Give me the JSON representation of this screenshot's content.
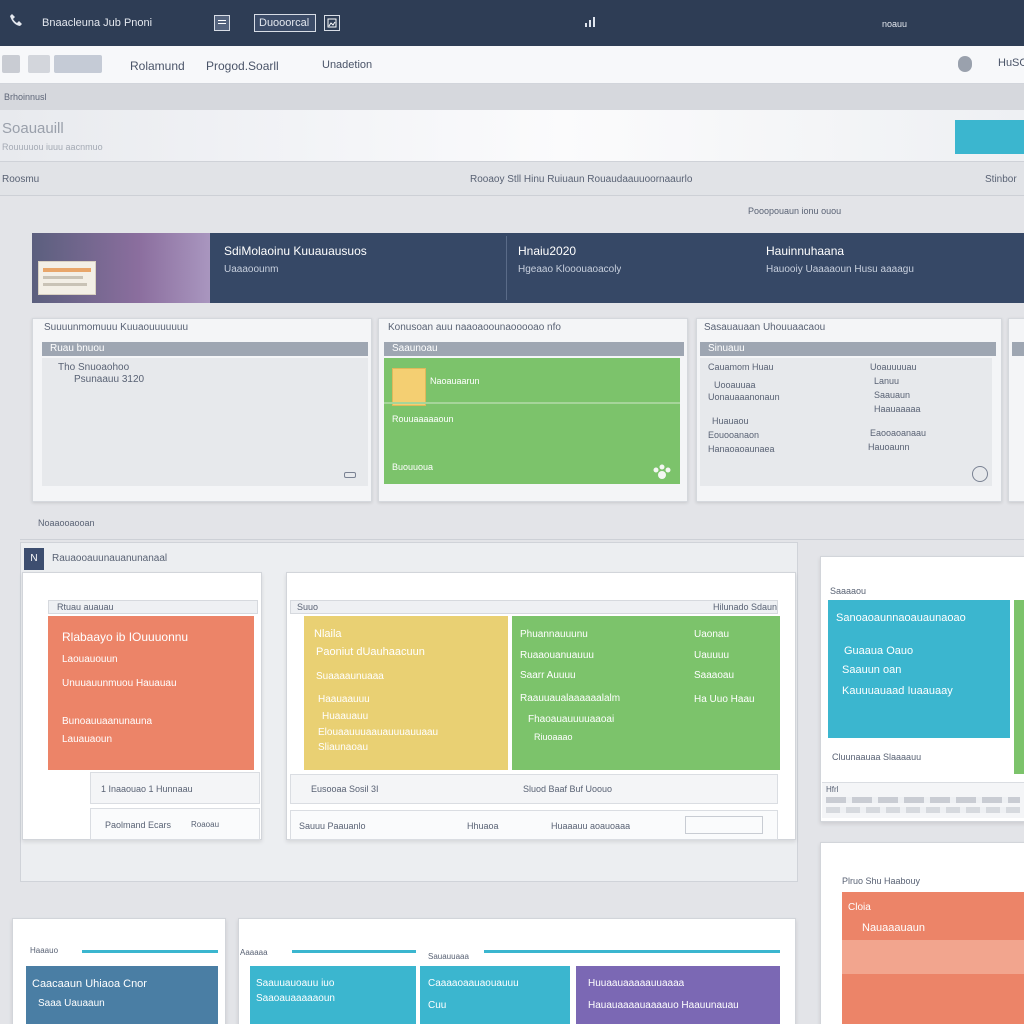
{
  "topbar": {
    "title": "Bnaacleuna Jub Pnoni",
    "doc_label": "Duooorcal",
    "right_text": "noauu"
  },
  "nav": {
    "items": [
      "Rolamund",
      "Progod.Soarll",
      "Unadetion"
    ],
    "user_label": "HuSO"
  },
  "subheader": {
    "label": "Brhoinnusl"
  },
  "hero": {
    "title": "Soauauill",
    "subtitle": "Rouuuuou iuuu aacnmuo"
  },
  "filterbar": {
    "left": "Roosmu",
    "center": "Rooaoy Stll Hinu Ruiuaun Rouaudaauuoornaaurlo",
    "right": "Stinbor"
  },
  "section_caption": "Pooopouaun ionu ouou",
  "banner": {
    "col1_title": "SdiMolaoinu Kuuauausuos",
    "col1_sub": "Uaaaoounm",
    "col2_title": "Hnaiu2020",
    "col2_sub": "Hgeaao Klooouaoacoly",
    "col3_title": "Hauinnuhaana",
    "col3_sub": "Hauooiy Uaaaaoun Husu aaaagu"
  },
  "cards_row1": [
    {
      "title": "Suuuunmomuuu Kuuaouuuuuuu",
      "header": "Ruau bnuou",
      "lines": [
        "Tho Snuoaohoo",
        "Psunaauu 3120"
      ]
    },
    {
      "title": "Konusoan auu naaoaoounaooooao nfo",
      "header": "Saaunoau",
      "green_lines": [
        "Naoauaarun",
        "Rouuaaaaaoun",
        "Buouuoua"
      ]
    },
    {
      "title": "Sasauauaan Uhouuaacaou",
      "header": "Sinuauu",
      "left_lines": [
        "Cauamom Huau",
        "Uooauuaa",
        "Uonauaaanonaun",
        "Huauaou",
        "Eouooanaon",
        "Hanaoaoaunaea"
      ],
      "right_lines": [
        "Uoauuuuau",
        "Lanuu",
        "Saauaun",
        "Haauaaaaa",
        "Eaooaoanaau",
        "Hauoaunn"
      ]
    }
  ],
  "section2_label": "Noaaooaooan",
  "board": {
    "title": "Rauaooauunauanunanaal",
    "left_panel": {
      "header": "Rtuau auauau",
      "orange_title": "Rlabaayo ib IOuuuonnu",
      "orange_lines": [
        "Laouauouun",
        "Unuuauunmuou Hauauau",
        "Bunoauuaanunauna",
        "Lauauaoun"
      ],
      "footer1": "1 Inaaouao 1 Hunnaau",
      "footer2": "Paolmand Ecars",
      "footer2_right": "Roaoau"
    },
    "mid_panel": {
      "header": "Suuo",
      "header_right": "Hilunado Sdaun",
      "yellow_lines": [
        "Nlaila",
        "Paoniut dUauhaacuun",
        "Suaaaaunuaaa",
        "Haauaauuu",
        "Huaauauu",
        "Elouaauuuaauauuuauuaau",
        "Sliaunaoau"
      ],
      "green_left": [
        "Phuannauuunu",
        "Ruaaouanuauuu",
        "Saarr Auuuu",
        "Raauuaualaaaaaalalm",
        "Fhaoauauuuuaaoai",
        "Riuoaaao"
      ],
      "green_right": [
        "Uaonau",
        "Uauuuu",
        "Saaaoau",
        "Ha Uuo Haau"
      ],
      "footer1": "Eusooaa Sosil 3I",
      "footer1_right": "Sluod Baaf Buf Uoouo",
      "footer2": "Sauuu Paauanlo",
      "footer2_mid": "Hhuaoa",
      "footer2_right": "Huaaauu aoauoaaa"
    }
  },
  "right_card": {
    "header": "Saaaaou",
    "cyan_title": "Sanoaoaunnaoauaunaoao",
    "cyan_lines": [
      "Guaaua Oauo",
      "Saauun oan",
      "Kauuuauaad Iuaauaay"
    ],
    "footer": "Cluunaauaa Slaaaauu",
    "mini_label": "Hfrl"
  },
  "right_card2": {
    "header": "Plruo Shu Haabouy",
    "orange_lines": [
      "Cloia",
      "Nauaaauaun"
    ]
  },
  "bottom_left": {
    "header": "Haaauo",
    "tile_title": "Caacaaun Uhiaoa Cnor",
    "tile_sub": "Saaa Uauaaun"
  },
  "bottom_mid": {
    "header": "Aaaaaa",
    "header_mid": "Sauauuaaa",
    "tile1_title": "Saauuauoauu iuo",
    "tile1_sub": "Saaoauaaaaaoun",
    "tile2_title": "Caaaaoaauaouauuu",
    "tile2_sub": "Cuu",
    "tile3_title": "Huuaauaaaaauuaaaa",
    "tile3_sub": "Hauauaaaauaaaauo Haauunauau"
  },
  "colors": {
    "topbar": "#2e3d55",
    "banner": "#364866",
    "green": "#7cc36b",
    "orange": "#ec8468",
    "yellow": "#e9d073",
    "cyan": "#3bb6cf",
    "steel": "#4a7ea4",
    "purple": "#7b68b4"
  }
}
